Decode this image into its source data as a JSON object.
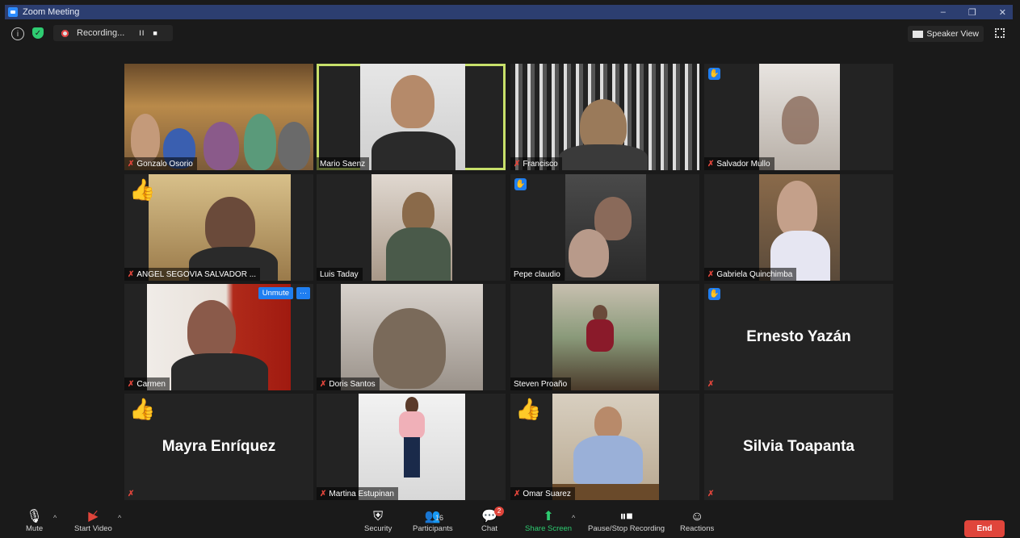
{
  "window": {
    "title": "Zoom Meeting",
    "controls": [
      "–",
      "❐",
      "✕"
    ]
  },
  "topbar": {
    "info_icon": "info-icon",
    "shield_icon": "shield-icon",
    "recording_label": "Recording...",
    "recording_pause": "II",
    "recording_stop": "■",
    "speaker_view_label": "Speaker View"
  },
  "tiles": [
    {
      "name": "Gonzalo Osorio",
      "muted": true
    },
    {
      "name": "Mario Saenz",
      "muted": false,
      "active": true
    },
    {
      "name": "Francisco",
      "muted": true
    },
    {
      "name": "Salvador Mullo",
      "muted": true,
      "hand": true
    },
    {
      "name": "ANGEL SEGOVIA SALVADOR ...",
      "muted": true,
      "reaction": "👍"
    },
    {
      "name": "Luis Taday",
      "muted": false
    },
    {
      "name": "Pepe claudio",
      "muted": false,
      "hand": true
    },
    {
      "name": "Gabriela Quinchimba",
      "muted": true
    },
    {
      "name": "Carmen",
      "muted": true,
      "unmute_label": "Unmute",
      "more_label": "···"
    },
    {
      "name": "Doris Santos",
      "muted": true
    },
    {
      "name": "Steven Proaño",
      "muted": false
    },
    {
      "name": "Ernesto Yazán",
      "muted": true,
      "hand": true,
      "video_off": true
    },
    {
      "name": "Mayra Enríquez",
      "muted": true,
      "reaction": "👍",
      "video_off": true
    },
    {
      "name": "Martina Estupinan",
      "muted": true
    },
    {
      "name": "Omar Suarez",
      "muted": true,
      "reaction": "👍"
    },
    {
      "name": "Silvia Toapanta",
      "muted": true,
      "video_off": true
    }
  ],
  "toolbar": {
    "mute": "Mute",
    "start_video": "Start Video",
    "security": "Security",
    "participants": "Participants",
    "participants_count": "16",
    "chat": "Chat",
    "chat_badge": "2",
    "share_screen": "Share Screen",
    "pause_stop_recording": "Pause/Stop Recording",
    "reactions": "Reactions",
    "end": "End"
  },
  "colors": {
    "titlebar": "#2c3e70",
    "active_speaker": "#c8e06a",
    "accent_blue": "#1f7ef0",
    "end_red": "#e0453b",
    "share_green": "#2ecc71"
  }
}
